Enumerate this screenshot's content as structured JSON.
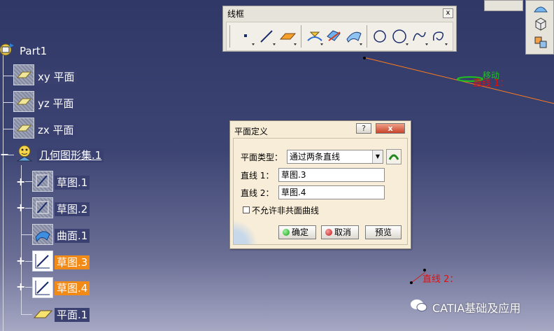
{
  "tree": {
    "root": "Part1",
    "planes": [
      "xy 平面",
      "yz 平面",
      "zx 平面"
    ],
    "geo_set": "几何图形集.1",
    "children": [
      {
        "label": "草图.1",
        "state": "normal"
      },
      {
        "label": "草图.2",
        "state": "normal"
      },
      {
        "label": "曲面.1",
        "state": "normal"
      },
      {
        "label": "草图.3",
        "state": "selected"
      },
      {
        "label": "草图.4",
        "state": "selected"
      },
      {
        "label": "平面.1",
        "state": "normal"
      }
    ]
  },
  "toolbar": {
    "title": "线框",
    "close": "x",
    "icons": [
      "point-icon",
      "line-icon",
      "plane-icon",
      "projection-icon",
      "intersection-icon",
      "offset-curve-icon",
      "circle-icon",
      "arc-icon",
      "spline-icon",
      "helix-icon"
    ]
  },
  "dialog": {
    "title": "平面定义",
    "help": "?",
    "minimize": "_",
    "close": "x",
    "plane_type_label": "平面类型：",
    "plane_type_value": "通过两条直线",
    "line1_label": "直线 1：",
    "line1_value": "草图.3",
    "line2_label": "直线 2：",
    "line2_value": "草图.4",
    "checkbox_label": "不允许非共面曲线",
    "checkbox_checked": false,
    "ok": "确定",
    "cancel": "取消",
    "preview": "预览"
  },
  "viewport": {
    "move_label": "移动",
    "line1_tag": "直线 1：",
    "line2_tag": "直线 2："
  },
  "watermark": "CATIA基础及应用",
  "colors": {
    "selected": "#f28a17",
    "annotation_red": "#e01010",
    "annotation_green": "#1ec21e"
  }
}
